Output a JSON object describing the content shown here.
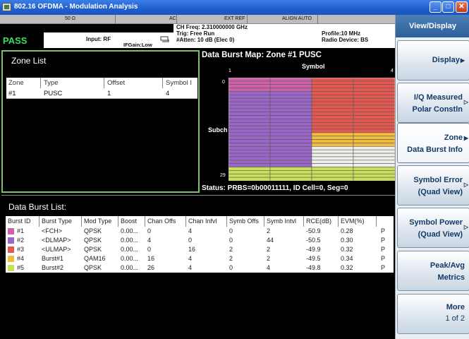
{
  "window": {
    "title": "802.16 OFDMA - Modulation Analysis",
    "buttons": {
      "minimize": "_",
      "maximize": "□",
      "close": "✕"
    }
  },
  "header": {
    "impedance": "50 Ω",
    "coupling": "AC",
    "ref": "EXT REF",
    "align": "ALIGN AUTO",
    "status": "PASS",
    "input": "Input: RF",
    "ifgain": "IFGain:Low",
    "ch_freq": "CH Freq: 2.310000000 GHz",
    "trig": "Trig: Free Run",
    "atten": "#Atten: 10 dB (Elec 0)",
    "profile": "Profile:10 MHz",
    "radio_device": "Radio Device: BS"
  },
  "zone_list": {
    "title": "Zone List",
    "columns": [
      "Zone",
      "Type",
      "Offset",
      "Symbol I"
    ],
    "rows": [
      {
        "zone": "#1",
        "type": "PUSC",
        "offset": "1",
        "symbol": "4"
      }
    ]
  },
  "burst_map": {
    "title": "Data Burst Map: Zone #1 PUSC",
    "x_label": "Symbol",
    "x_min": "1",
    "x_max": "4",
    "y_label": "Subch",
    "y_min": "0",
    "y_max": "29",
    "status": "Status: PRBS=0b00011111, ID Cell=0, Seg=0",
    "colors": {
      "FCH": "#d060a8",
      "DLMAP": "#9a66c8",
      "ULMAP": "#e45850",
      "Burst1": "#f2bd3c",
      "Burst2": "#c8e05a",
      "empty": "#f0eee8"
    }
  },
  "burst_list": {
    "title": "Data Burst List:",
    "columns": [
      "Burst ID",
      "Burst Type",
      "Mod Type",
      "Boost",
      "Chan Offs",
      "Chan Infvl",
      "Symb Offs",
      "Symb Intvl",
      "RCE(dB)",
      "EVM(%)",
      ""
    ],
    "rows": [
      {
        "color": "#d060a8",
        "id": "#1",
        "type": "<FCH>",
        "mod": "QPSK",
        "boost": "0.00...",
        "chan_offs": "0",
        "chan_intvl": "4",
        "symb_offs": "0",
        "symb_intvl": "2",
        "rce": "-50.9",
        "evm": "0.28",
        "result": "P"
      },
      {
        "color": "#9a66c8",
        "id": "#2",
        "type": "<DLMAP>",
        "mod": "QPSK",
        "boost": "0.00...",
        "chan_offs": "4",
        "chan_intvl": "0",
        "symb_offs": "0",
        "symb_intvl": "44",
        "rce": "-50.5",
        "evm": "0.30",
        "result": "P"
      },
      {
        "color": "#e45850",
        "id": "#3",
        "type": "<ULMAP>",
        "mod": "QPSK",
        "boost": "0.00...",
        "chan_offs": "0",
        "chan_intvl": "16",
        "symb_offs": "2",
        "symb_intvl": "2",
        "rce": "-49.9",
        "evm": "0.32",
        "result": "P"
      },
      {
        "color": "#f2bd3c",
        "id": "#4",
        "type": "Burst#1",
        "mod": "QAM16",
        "boost": "0.00...",
        "chan_offs": "16",
        "chan_intvl": "4",
        "symb_offs": "2",
        "symb_intvl": "2",
        "rce": "-49.5",
        "evm": "0.34",
        "result": "P"
      },
      {
        "color": "#c8e05a",
        "id": "#5",
        "type": "Burst#2",
        "mod": "QPSK",
        "boost": "0.00...",
        "chan_offs": "26",
        "chan_intvl": "4",
        "symb_offs": "0",
        "symb_intvl": "4",
        "rce": "-49.8",
        "evm": "0.32",
        "result": "P"
      }
    ]
  },
  "softkeys": {
    "header": "View/Display",
    "keys": [
      {
        "l1": "Display",
        "l2": "",
        "arrow": "▶"
      },
      {
        "l1": "I/Q Measured",
        "l2": "Polar Constln",
        "arrow": "▷"
      },
      {
        "l1": "Zone",
        "l2": "Data Burst Info",
        "arrow": "▶"
      },
      {
        "l1": "Symbol Error",
        "l2": "(Quad View)",
        "arrow": "▷"
      },
      {
        "l1": "Symbol Power",
        "l2": "(Quad View)",
        "arrow": "▷"
      },
      {
        "l1": "Peak/Avg",
        "l2": "Metrics",
        "arrow": ""
      },
      {
        "l1": "More",
        "l2": "1 of 2",
        "arrow": ""
      }
    ]
  }
}
